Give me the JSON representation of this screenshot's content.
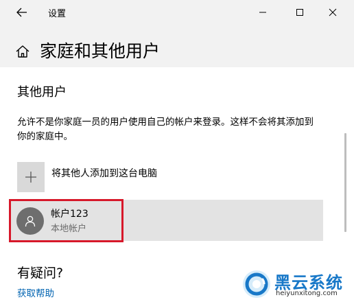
{
  "window": {
    "title": "设置"
  },
  "header": {
    "page_title": "家庭和其他用户"
  },
  "other_users": {
    "section_title": "其他用户",
    "description": "允许不是你家庭一员的用户使用自己的帐户来登录。这样不会将其添加到你的家庭中。",
    "add_label": "将其他人添加到这台电脑",
    "accounts": [
      {
        "name": "帐户123",
        "type": "本地帐户"
      }
    ]
  },
  "help": {
    "question": "有疑问?",
    "link": "获取帮助"
  },
  "watermark": {
    "brand": "黑云系统",
    "url": "heiyunxitong.com"
  },
  "colors": {
    "titlebar_bg": "#f2f2f2",
    "link": "#0063b1",
    "highlight_border": "#d7182a",
    "watermark_blue": "#1878c8"
  },
  "icons": [
    "back-arrow-icon",
    "minimize-icon",
    "maximize-icon",
    "close-icon",
    "home-icon",
    "plus-icon",
    "user-avatar-icon"
  ]
}
